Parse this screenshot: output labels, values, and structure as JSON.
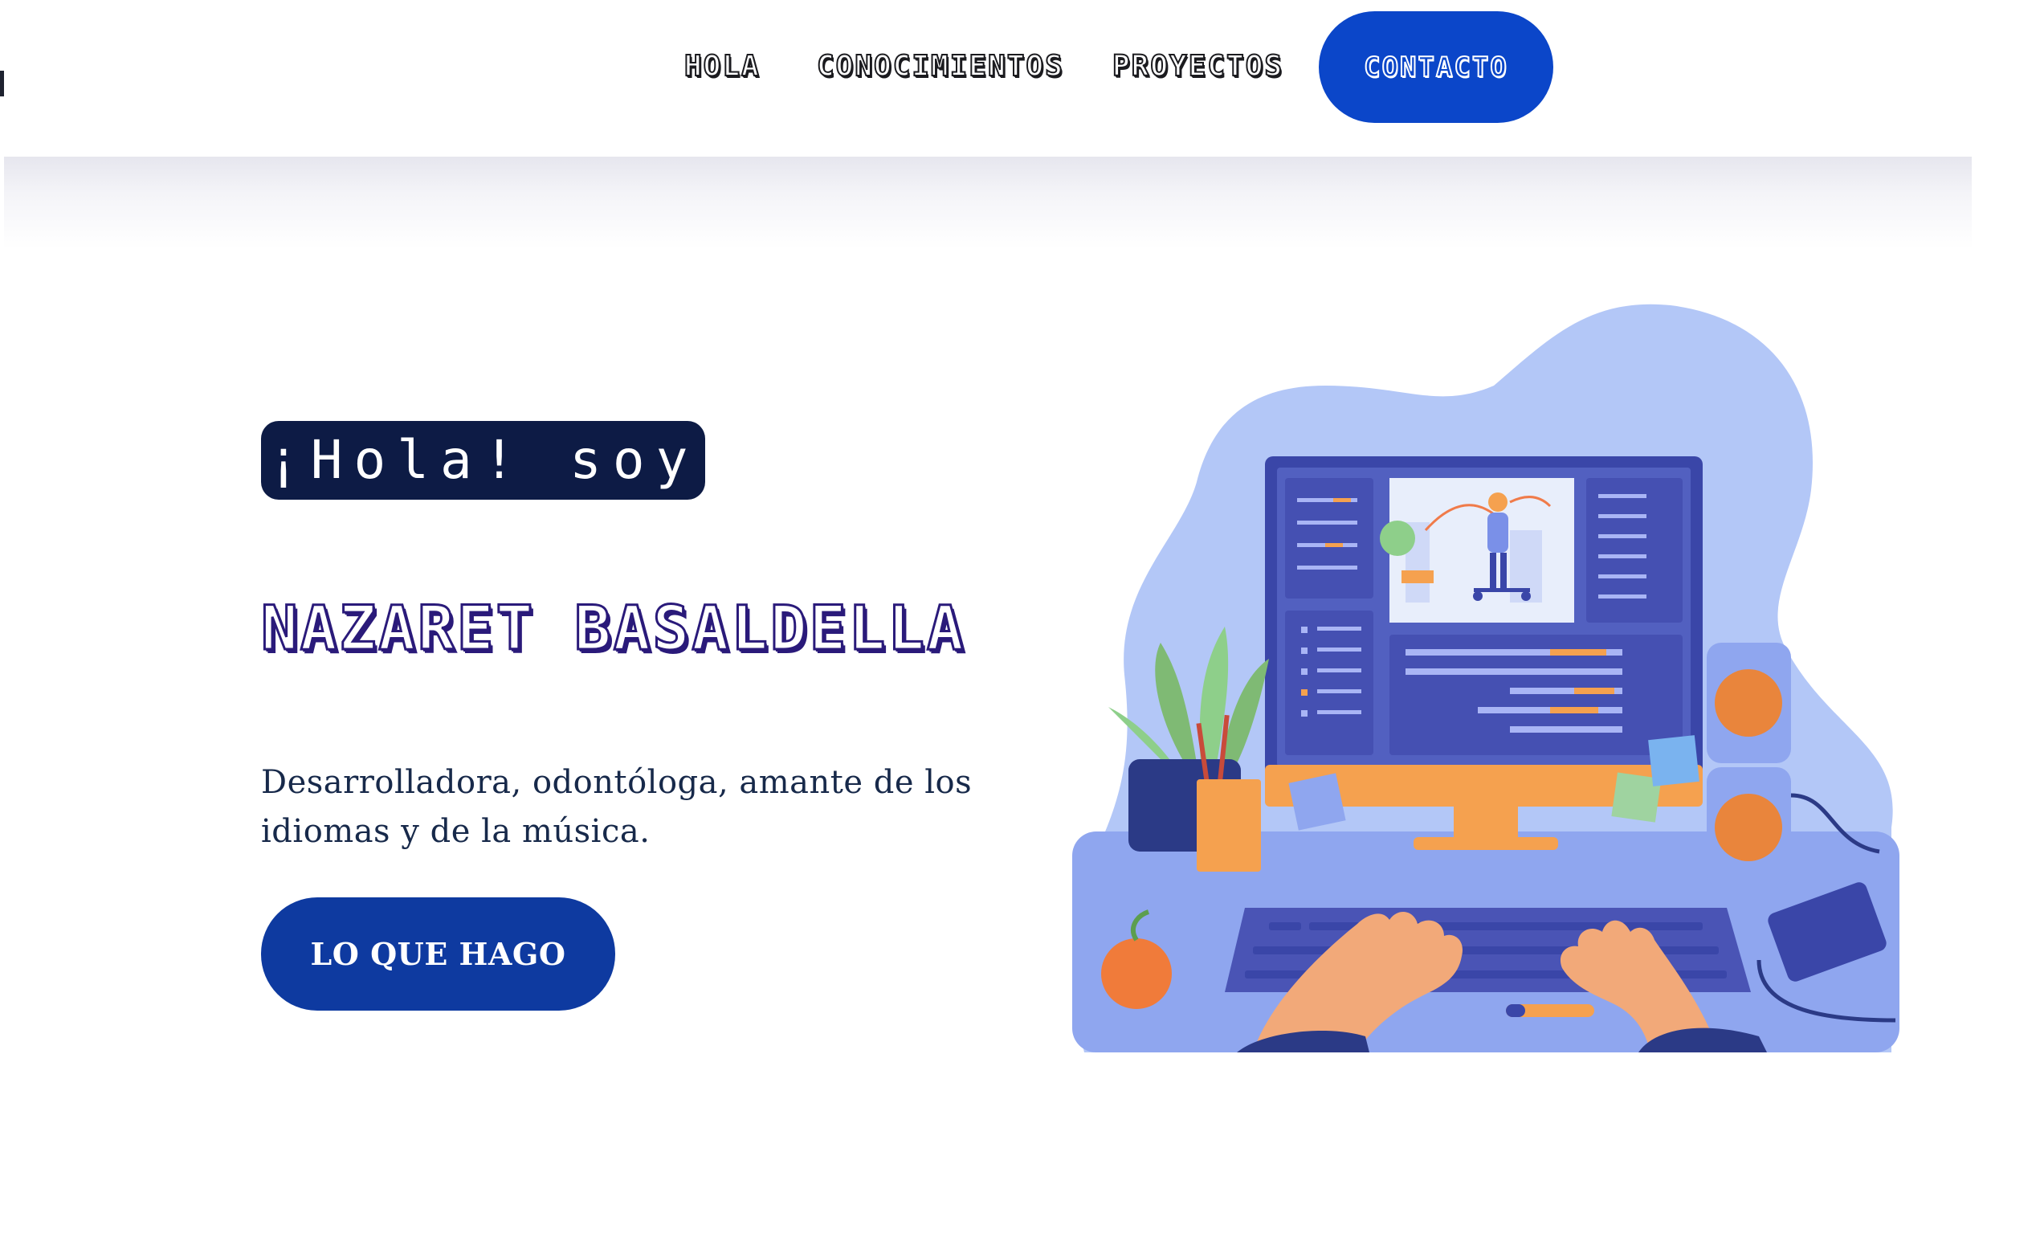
{
  "nav": {
    "links": [
      {
        "label": "HOLA"
      },
      {
        "label": "CONOCIMIENTOS"
      },
      {
        "label": "PROYECTOS"
      }
    ],
    "cta_label": "CONTACTO"
  },
  "hero": {
    "greeting": "¡Hola! soy",
    "name": "NAZARET BASALDELLA",
    "description": "Desarrolladora, odontóloga, amante de los idiomas y de la música.",
    "button_label": "LO QUE HAGO"
  },
  "illustration": {
    "icon": "person-at-desktop-editing-video-illustration"
  },
  "colors": {
    "primary_blue": "#0b46c9",
    "hero_button_blue": "#0e3aa0",
    "greeting_bg": "#0d1b45",
    "name_outline": "#2a1a7a",
    "text": "#17294a",
    "illustration_blob": "#b3c7f7",
    "illustration_orange": "#f5a14f"
  }
}
